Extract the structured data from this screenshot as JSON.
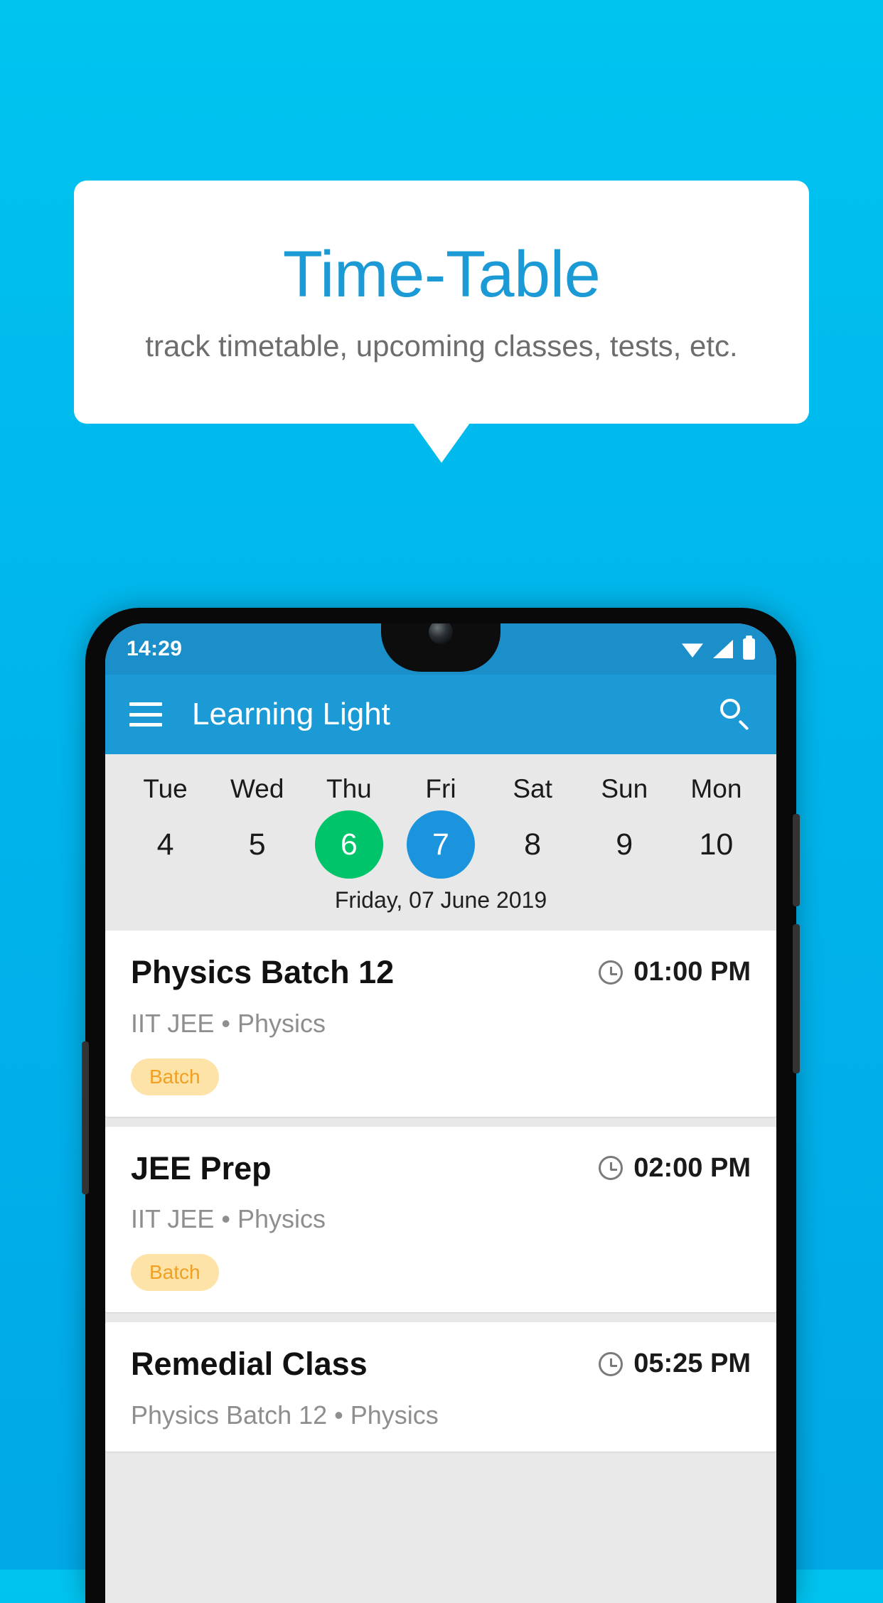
{
  "promo": {
    "title": "Time-Table",
    "subtitle": "track timetable, upcoming classes, tests, etc.",
    "title_color": "#1c9ad6",
    "background_color": "#00b6ec"
  },
  "phone": {
    "statusbar": {
      "time": "14:29",
      "icons": [
        "wifi-icon",
        "signal-icon",
        "battery-icon"
      ]
    },
    "appbar": {
      "menu_icon": "hamburger-menu-icon",
      "title": "Learning Light",
      "search_icon": "search-icon",
      "background_color": "#1c9ad6"
    },
    "datestrip": {
      "days": [
        {
          "name": "Tue",
          "num": "4",
          "state": "normal"
        },
        {
          "name": "Wed",
          "num": "5",
          "state": "normal"
        },
        {
          "name": "Thu",
          "num": "6",
          "state": "today"
        },
        {
          "name": "Fri",
          "num": "7",
          "state": "selected"
        },
        {
          "name": "Sat",
          "num": "8",
          "state": "normal"
        },
        {
          "name": "Sun",
          "num": "9",
          "state": "normal"
        },
        {
          "name": "Mon",
          "num": "10",
          "state": "normal"
        }
      ],
      "selected_date_label": "Friday, 07 June 2019",
      "today_color": "#00c46a",
      "selected_color": "#1c93dd"
    },
    "classes": [
      {
        "title": "Physics Batch 12",
        "time": "01:00 PM",
        "subtitle": "IIT JEE • Physics",
        "tag": "Batch"
      },
      {
        "title": "JEE Prep",
        "time": "02:00 PM",
        "subtitle": "IIT JEE • Physics",
        "tag": "Batch"
      },
      {
        "title": "Remedial Class",
        "time": "05:25 PM",
        "subtitle": "Physics Batch 12 • Physics",
        "tag": ""
      }
    ],
    "tag_colors": {
      "background": "#fde3a7",
      "text": "#f0a023"
    }
  }
}
